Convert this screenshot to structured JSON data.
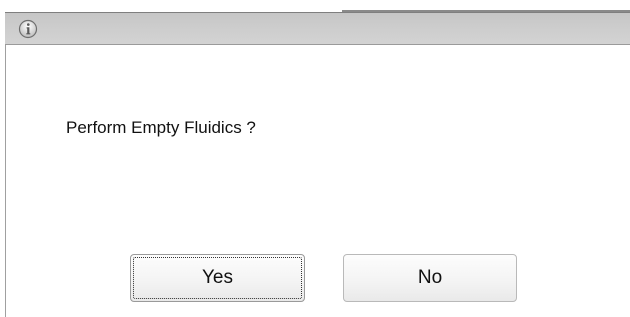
{
  "dialog": {
    "title_icon": "info-icon",
    "message": "Perform Empty Fluidics ?",
    "buttons": {
      "yes_label": "Yes",
      "no_label": "No"
    }
  },
  "colors": {
    "titlebar": "#cdcdcd",
    "background": "#ffffff",
    "text": "#111111"
  }
}
